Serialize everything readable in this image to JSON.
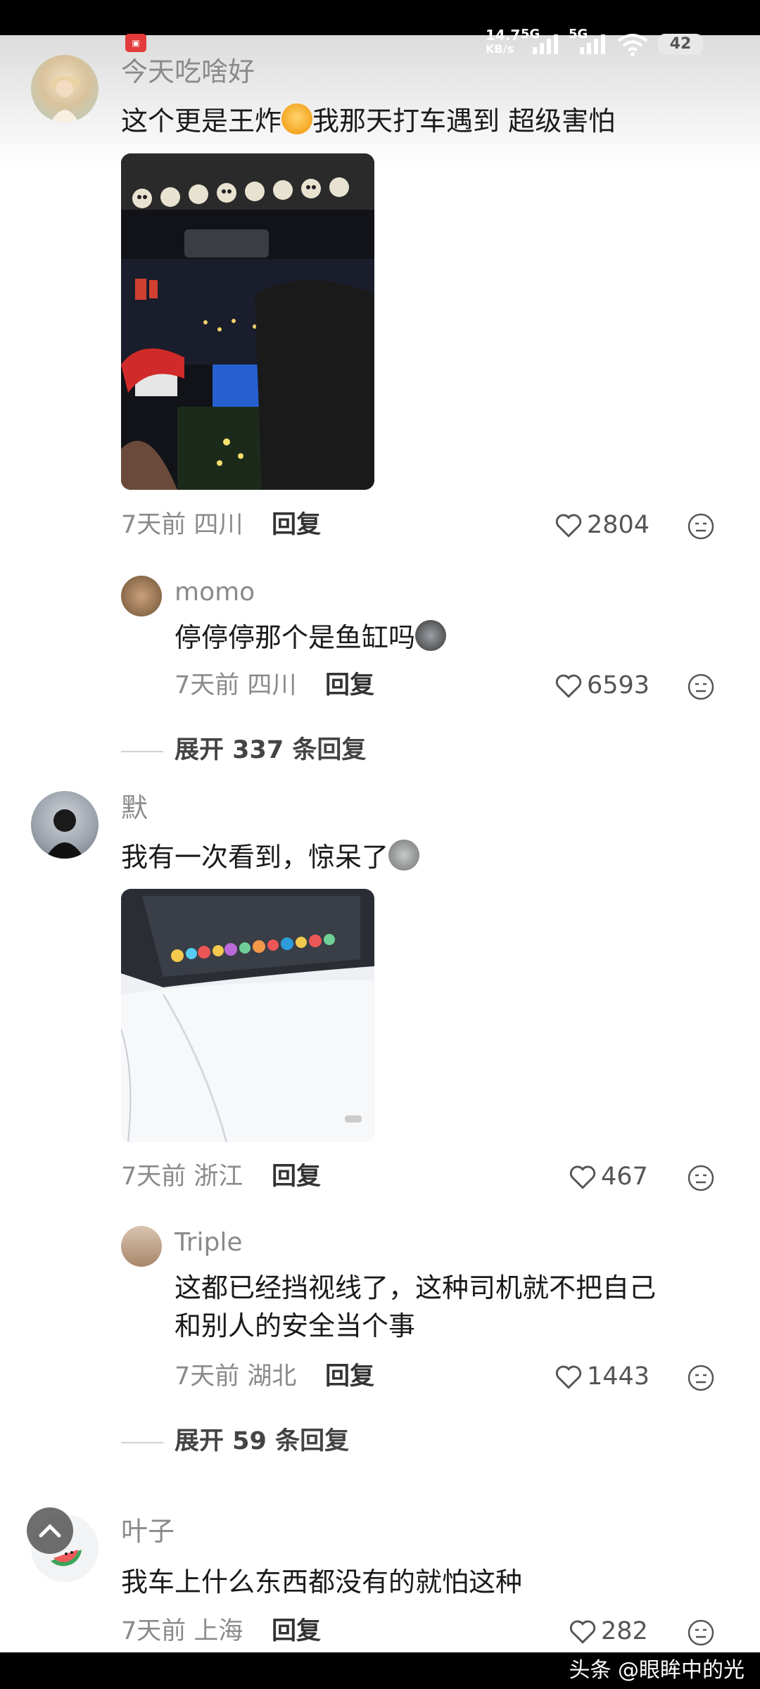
{
  "status_bar": {
    "speed": "14.7",
    "speed_unit": "KB/s",
    "network1": "5G",
    "network2": "5G",
    "battery": "42"
  },
  "comments": [
    {
      "username": "今天吃啥好",
      "text_before": "这个更是王炸",
      "text_after": "我那天打车遇到 超级害怕",
      "time": "7天前",
      "location": "四川",
      "reply_label": "回复",
      "likes": "2804"
    },
    {
      "username": "momo",
      "text": "停停停那个是鱼缸吗",
      "time": "7天前",
      "location": "四川",
      "reply_label": "回复",
      "likes": "6593"
    },
    {
      "username": "默",
      "text": "我有一次看到，惊呆了",
      "time": "7天前",
      "location": "浙江",
      "reply_label": "回复",
      "likes": "467"
    },
    {
      "username": "Triple",
      "text_line1": "这都已经挡视线了，这种司机就不把自己",
      "text_line2": "和别人的安全当个事",
      "time": "7天前",
      "location": "湖北",
      "reply_label": "回复",
      "likes": "1443"
    },
    {
      "username": "叶子",
      "text": "我车上什么东西都没有的就怕这种",
      "time": "7天前",
      "location": "上海",
      "reply_label": "回复",
      "likes": "282"
    }
  ],
  "expand_replies": [
    {
      "label": "展开 337 条回复"
    },
    {
      "label": "展开 59 条回复"
    }
  ],
  "watermark": "头条 @眼眸中的光",
  "colors": {
    "text_primary": "#1a1a1a",
    "text_secondary": "#8a8a8a",
    "background": "#ffffff"
  }
}
